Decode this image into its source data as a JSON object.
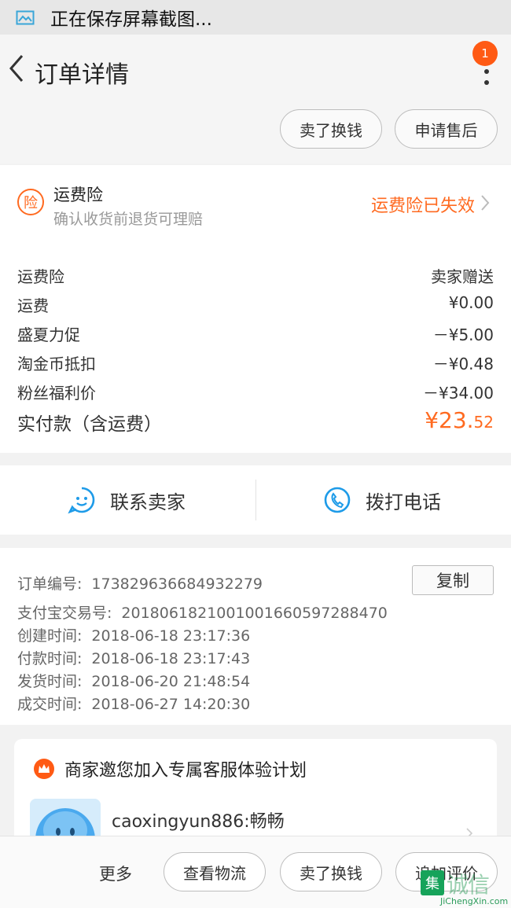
{
  "status_bar": {
    "text": "正在保存屏幕截图..."
  },
  "nav": {
    "title": "订单详情",
    "badge_count": "1"
  },
  "top_actions": {
    "sell": "卖了换钱",
    "after_sale": "申请售后"
  },
  "insurance": {
    "icon_char": "险",
    "title": "运费险",
    "subtitle": "确认收货前退货可理赔",
    "status": "运费险已失效"
  },
  "price_rows": [
    {
      "label": "运费险",
      "value": "卖家赠送"
    },
    {
      "label": "运费",
      "value": "¥0.00"
    },
    {
      "label": "盛夏力促",
      "value": "－¥5.00"
    },
    {
      "label": "淘金币抵扣",
      "value": "－¥0.48"
    },
    {
      "label": "粉丝福利价",
      "value": "－¥34.00"
    }
  ],
  "total": {
    "label": "实付款（含运费）",
    "currency_int": "¥23.",
    "decimal": "52"
  },
  "contact": {
    "seller": "联系卖家",
    "phone": "拨打电话"
  },
  "order_info": {
    "order_no_label": "订单编号:",
    "order_no": "173829636684932279",
    "copy": "复制",
    "alipay_label": "支付宝交易号:",
    "alipay_no": "2018061821001001660597288470",
    "created_label": "创建时间:",
    "created": "2018-06-18 23:17:36",
    "paid_label": "付款时间:",
    "paid": "2018-06-18 23:17:43",
    "shipped_label": "发货时间:",
    "shipped": "2018-06-20 21:48:54",
    "closed_label": "成交时间:",
    "closed": "2018-06-27 14:20:30"
  },
  "service": {
    "title": "商家邀您加入专属客服体验计划",
    "agent": "caoxingyun886:畅畅"
  },
  "bottom": {
    "more": "更多",
    "logistics": "查看物流",
    "sell": "卖了换钱",
    "review": "追加评价"
  },
  "watermark": {
    "logo_char": "集",
    "cn": "诚信",
    "en": "JiChengXin.com"
  },
  "colors": {
    "accent": "#ff6a20",
    "icon_blue": "#1e9be8",
    "badge": "#ff5a14"
  }
}
